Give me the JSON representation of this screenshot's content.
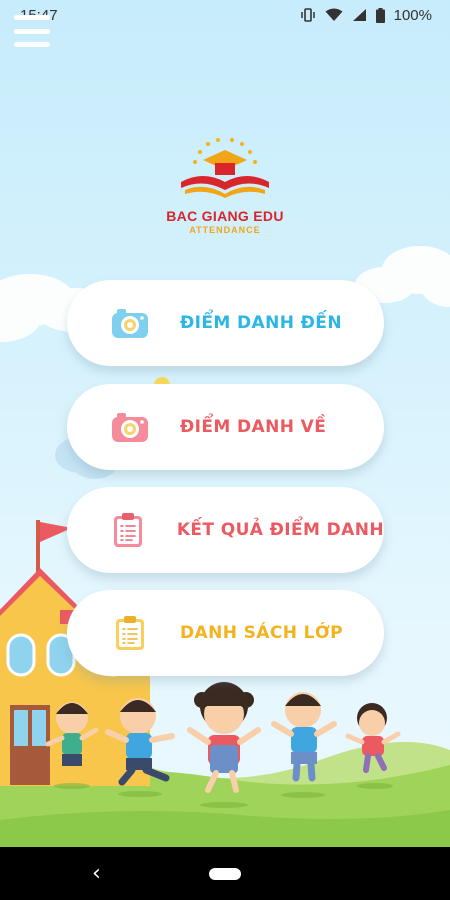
{
  "status_bar": {
    "time": "15:47",
    "battery": "100%",
    "icons": [
      "vibrate-icon",
      "wifi-icon",
      "signal-icon",
      "battery-icon"
    ]
  },
  "header": {
    "menu_icon": "hamburger-menu-icon"
  },
  "logo": {
    "title": "BAC GIANG EDU",
    "subtitle": "ATTENDANCE"
  },
  "menu": {
    "items": [
      {
        "label": "ĐIỂM DANH ĐẾN",
        "icon": "camera-icon",
        "color": "#2cb6e6"
      },
      {
        "label": "ĐIỂM DANH VỀ",
        "icon": "camera-icon",
        "color": "#ec5a61"
      },
      {
        "label": "KẾT QUẢ ĐIỂM DANH",
        "icon": "clipboard-icon",
        "color": "#ec5a61"
      },
      {
        "label": "DANH SÁCH LỚP",
        "icon": "clipboard-icon",
        "color": "#f2b320"
      }
    ]
  },
  "nav_bar": {
    "back_icon": "‹"
  },
  "colors": {
    "sky": "#c7ecfb",
    "grass": "#9fd35a",
    "logo_red": "#d8262c",
    "logo_orange": "#f2a516"
  }
}
